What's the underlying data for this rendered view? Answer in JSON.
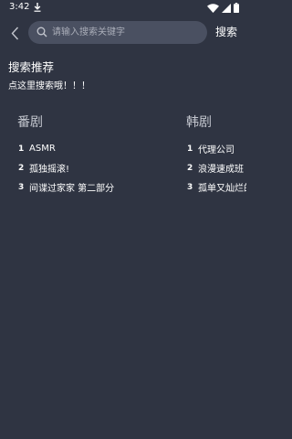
{
  "status_bar": {
    "time": "3:42",
    "icons": [
      "download-icon",
      "wifi-icon",
      "signal-icon",
      "battery-icon"
    ]
  },
  "search": {
    "placeholder": "请输入搜索关键字",
    "value": "",
    "button_label": "搜索"
  },
  "recommend": {
    "title": "搜索推荐",
    "hint": "点这里搜索哦！！！"
  },
  "lists": [
    {
      "title": "番剧",
      "items": [
        {
          "rank": "1",
          "name": "ASMR"
        },
        {
          "rank": "2",
          "name": "孤独摇滚!"
        },
        {
          "rank": "3",
          "name": "间谍过家家 第二部分"
        }
      ]
    },
    {
      "title": "韩剧",
      "items": [
        {
          "rank": "1",
          "name": "代理公司"
        },
        {
          "rank": "2",
          "name": "浪漫速成班"
        },
        {
          "rank": "3",
          "name": "孤单又灿烂的神"
        }
      ]
    }
  ],
  "colors": {
    "background": "#2f3442",
    "search_box": "#4a5061",
    "list_title": "#c3c6ce",
    "placeholder": "#a9adb8"
  }
}
